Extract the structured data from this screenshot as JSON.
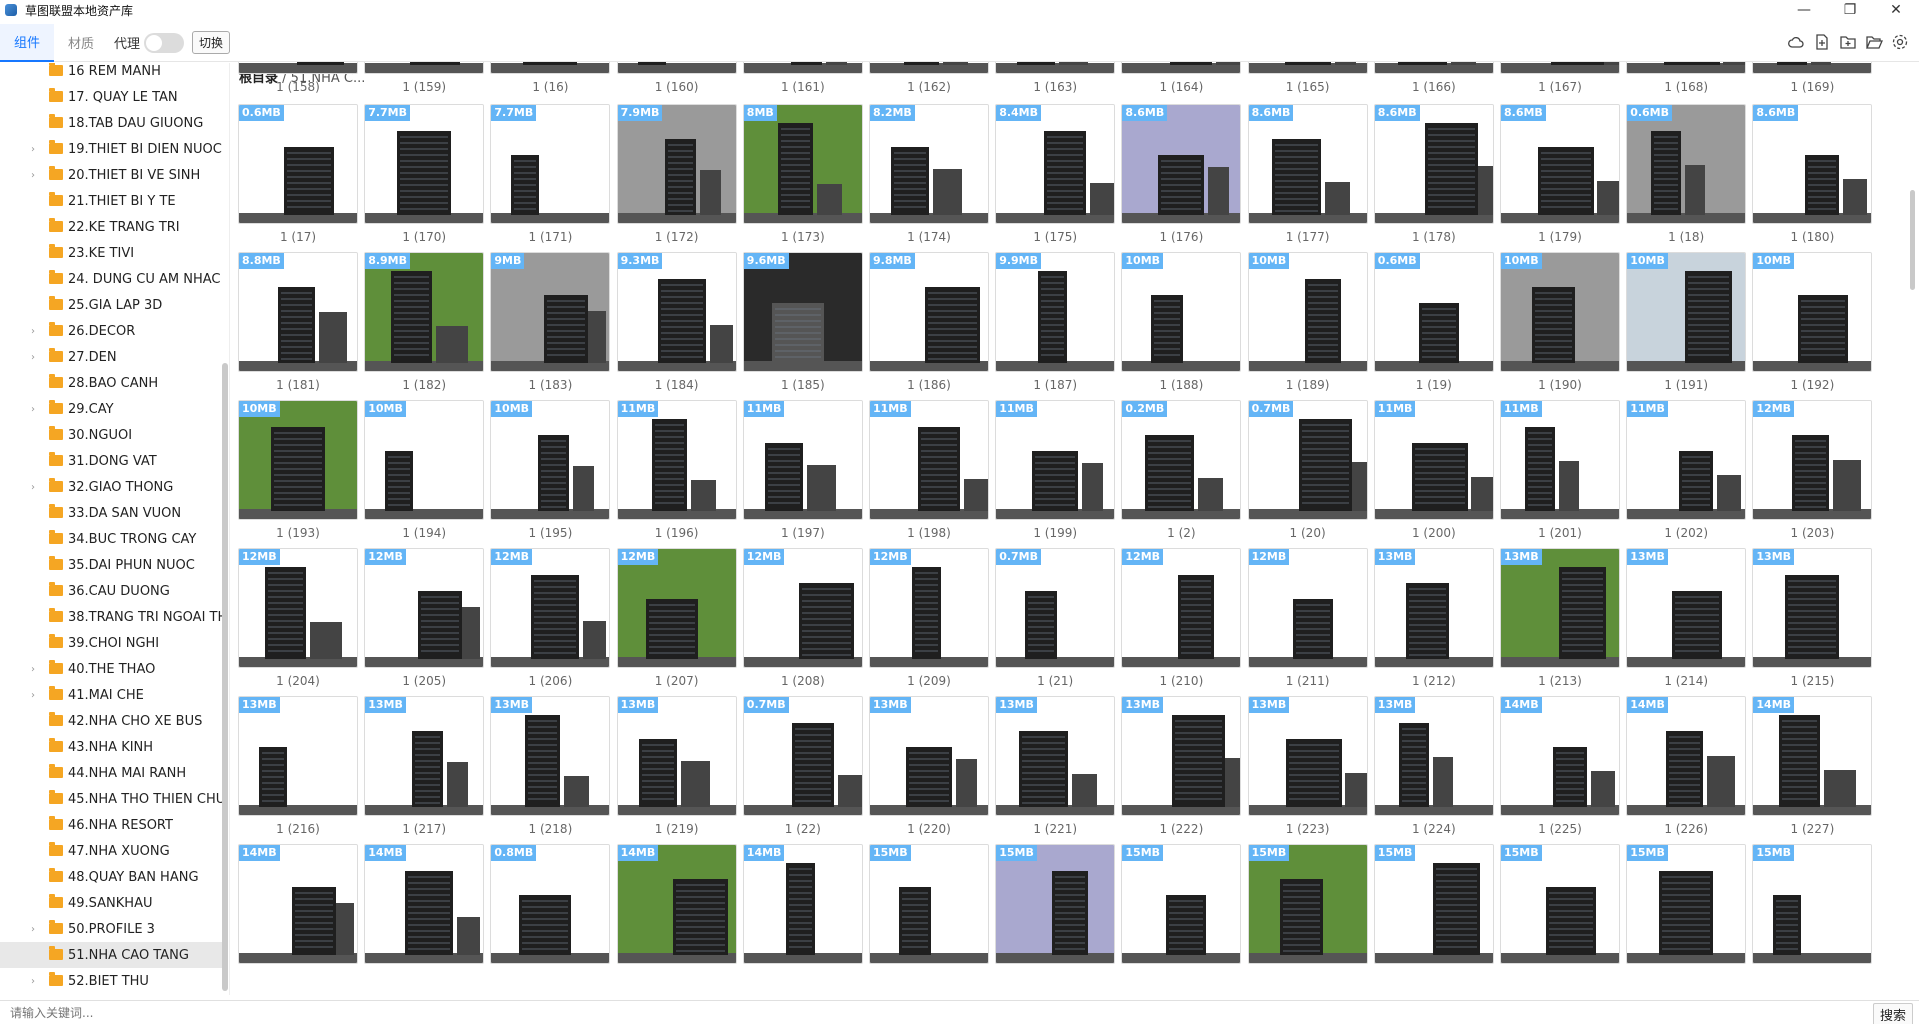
{
  "window": {
    "title": "草图联盟本地资产库",
    "minimize": "—",
    "maximize": "❐",
    "close": "✕"
  },
  "toolbar": {
    "tabs": [
      "组件",
      "材质"
    ],
    "proxy_label": "代理",
    "switch_label": "切换",
    "icons": [
      "cloud-icon",
      "add-file-icon",
      "add-folder-icon",
      "open-folder-icon",
      "settings-icon"
    ]
  },
  "breadcrumb": {
    "root": "根目录",
    "separator": " / ",
    "current": "51.NHA C..."
  },
  "sidebar": {
    "items": [
      {
        "label": "16 REM MANH",
        "caret": false
      },
      {
        "label": "17. QUAY LE TAN",
        "caret": false
      },
      {
        "label": "18.TAB DAU GIUONG",
        "caret": false
      },
      {
        "label": "19.THIET BI DIEN NUOC",
        "caret": true
      },
      {
        "label": "20.THIET BI VE SINH",
        "caret": true
      },
      {
        "label": "21.THIET BI Y TE",
        "caret": false
      },
      {
        "label": "22.KE TRANG TRI",
        "caret": false
      },
      {
        "label": "23.KE TIVI",
        "caret": false
      },
      {
        "label": "24. DUNG CU AM NHAC",
        "caret": false
      },
      {
        "label": "25.GIA LAP 3D",
        "caret": false
      },
      {
        "label": "26.DECOR",
        "caret": true
      },
      {
        "label": "27.DEN",
        "caret": true
      },
      {
        "label": "28.BAO CANH",
        "caret": false
      },
      {
        "label": "29.CAY",
        "caret": true
      },
      {
        "label": "30.NGUOI",
        "caret": false
      },
      {
        "label": "31.DONG VAT",
        "caret": false
      },
      {
        "label": "32.GIAO THONG",
        "caret": true
      },
      {
        "label": "33.DA SAN VUON",
        "caret": false
      },
      {
        "label": "34.BUC TRONG CAY",
        "caret": false
      },
      {
        "label": "35.DAI PHUN NUOC",
        "caret": false
      },
      {
        "label": "36.CAU DUONG",
        "caret": false
      },
      {
        "label": "38.TRANG TRI NGOAI TH",
        "caret": false
      },
      {
        "label": "39.CHOI NGHI",
        "caret": false
      },
      {
        "label": "40.THE THAO",
        "caret": true
      },
      {
        "label": "41.MAI CHE",
        "caret": true
      },
      {
        "label": "42.NHA CHO XE BUS",
        "caret": false
      },
      {
        "label": "43.NHA KINH",
        "caret": false
      },
      {
        "label": "44.NHA MAI RANH",
        "caret": false
      },
      {
        "label": "45.NHA THO THIEN CHU",
        "caret": false
      },
      {
        "label": "46.NHA RESORT",
        "caret": false
      },
      {
        "label": "47.NHA XUONG",
        "caret": false
      },
      {
        "label": "48.QUAY BAN HANG",
        "caret": false
      },
      {
        "label": "49.SANKHAU",
        "caret": false
      },
      {
        "label": "50.PROFILE 3",
        "caret": true
      },
      {
        "label": "51.NHA CAO TANG",
        "caret": false,
        "selected": true
      },
      {
        "label": "52.BIET THU",
        "caret": true
      }
    ]
  },
  "grid": {
    "top_captions": [
      "1 (158)",
      "1 (159)",
      "1 (16)",
      "1 (160)",
      "1 (161)",
      "1 (162)",
      "1 (163)",
      "1 (164)",
      "1 (165)",
      "1 (166)",
      "1 (167)",
      "1 (168)",
      "1 (169)"
    ],
    "rows": [
      [
        {
          "size": "0.6MB",
          "name": "1 (17)",
          "scene": "white"
        },
        {
          "size": "7.7MB",
          "name": "1 (170)",
          "scene": "white"
        },
        {
          "size": "7.7MB",
          "name": "1 (171)",
          "scene": "white"
        },
        {
          "size": "7.9MB",
          "name": "1 (172)",
          "scene": "grey"
        },
        {
          "size": "8MB",
          "name": "1 (173)",
          "scene": "green"
        },
        {
          "size": "8.2MB",
          "name": "1 (174)",
          "scene": "white"
        },
        {
          "size": "8.4MB",
          "name": "1 (175)",
          "scene": "white"
        },
        {
          "size": "8.6MB",
          "name": "1 (176)",
          "scene": "lavender"
        },
        {
          "size": "8.6MB",
          "name": "1 (177)",
          "scene": "white"
        },
        {
          "size": "8.6MB",
          "name": "1 (178)",
          "scene": "white"
        },
        {
          "size": "8.6MB",
          "name": "1 (179)",
          "scene": "white"
        },
        {
          "size": "0.6MB",
          "name": "1 (18)",
          "scene": "grey"
        },
        {
          "size": "8.6MB",
          "name": "1 (180)",
          "scene": "white"
        }
      ],
      [
        {
          "size": "8.8MB",
          "name": "1 (181)",
          "scene": "white"
        },
        {
          "size": "8.9MB",
          "name": "1 (182)",
          "scene": "green"
        },
        {
          "size": "9MB",
          "name": "1 (183)",
          "scene": "grey"
        },
        {
          "size": "9.3MB",
          "name": "1 (184)",
          "scene": "white"
        },
        {
          "size": "9.6MB",
          "name": "1 (185)",
          "scene": "dark"
        },
        {
          "size": "9.8MB",
          "name": "1 (186)",
          "scene": "white"
        },
        {
          "size": "9.9MB",
          "name": "1 (187)",
          "scene": "white"
        },
        {
          "size": "10MB",
          "name": "1 (188)",
          "scene": "white"
        },
        {
          "size": "10MB",
          "name": "1 (189)",
          "scene": "white"
        },
        {
          "size": "0.6MB",
          "name": "1 (19)",
          "scene": "white"
        },
        {
          "size": "10MB",
          "name": "1 (190)",
          "scene": "grey"
        },
        {
          "size": "10MB",
          "name": "1 (191)",
          "scene": "lightblue"
        },
        {
          "size": "10MB",
          "name": "1 (192)",
          "scene": "white"
        }
      ],
      [
        {
          "size": "10MB",
          "name": "1 (193)",
          "scene": "green"
        },
        {
          "size": "10MB",
          "name": "1 (194)",
          "scene": "white"
        },
        {
          "size": "10MB",
          "name": "1 (195)",
          "scene": "white"
        },
        {
          "size": "11MB",
          "name": "1 (196)",
          "scene": "white"
        },
        {
          "size": "11MB",
          "name": "1 (197)",
          "scene": "white"
        },
        {
          "size": "11MB",
          "name": "1 (198)",
          "scene": "white"
        },
        {
          "size": "11MB",
          "name": "1 (199)",
          "scene": "white"
        },
        {
          "size": "0.2MB",
          "name": "1 (2)",
          "scene": "white"
        },
        {
          "size": "0.7MB",
          "name": "1 (20)",
          "scene": "white"
        },
        {
          "size": "11MB",
          "name": "1 (200)",
          "scene": "white"
        },
        {
          "size": "11MB",
          "name": "1 (201)",
          "scene": "white"
        },
        {
          "size": "11MB",
          "name": "1 (202)",
          "scene": "white"
        },
        {
          "size": "12MB",
          "name": "1 (203)",
          "scene": "white"
        }
      ],
      [
        {
          "size": "12MB",
          "name": "1 (204)",
          "scene": "white"
        },
        {
          "size": "12MB",
          "name": "1 (205)",
          "scene": "white"
        },
        {
          "size": "12MB",
          "name": "1 (206)",
          "scene": "white"
        },
        {
          "size": "12MB",
          "name": "1 (207)",
          "scene": "green"
        },
        {
          "size": "12MB",
          "name": "1 (208)",
          "scene": "white"
        },
        {
          "size": "12MB",
          "name": "1 (209)",
          "scene": "white"
        },
        {
          "size": "0.7MB",
          "name": "1 (21)",
          "scene": "white"
        },
        {
          "size": "12MB",
          "name": "1 (210)",
          "scene": "white"
        },
        {
          "size": "12MB",
          "name": "1 (211)",
          "scene": "white"
        },
        {
          "size": "13MB",
          "name": "1 (212)",
          "scene": "white"
        },
        {
          "size": "13MB",
          "name": "1 (213)",
          "scene": "green"
        },
        {
          "size": "13MB",
          "name": "1 (214)",
          "scene": "white"
        },
        {
          "size": "13MB",
          "name": "1 (215)",
          "scene": "white"
        }
      ],
      [
        {
          "size": "13MB",
          "name": "1 (216)",
          "scene": "white"
        },
        {
          "size": "13MB",
          "name": "1 (217)",
          "scene": "white"
        },
        {
          "size": "13MB",
          "name": "1 (218)",
          "scene": "white"
        },
        {
          "size": "13MB",
          "name": "1 (219)",
          "scene": "white"
        },
        {
          "size": "0.7MB",
          "name": "1 (22)",
          "scene": "white"
        },
        {
          "size": "13MB",
          "name": "1 (220)",
          "scene": "white"
        },
        {
          "size": "13MB",
          "name": "1 (221)",
          "scene": "white"
        },
        {
          "size": "13MB",
          "name": "1 (222)",
          "scene": "white"
        },
        {
          "size": "13MB",
          "name": "1 (223)",
          "scene": "white"
        },
        {
          "size": "13MB",
          "name": "1 (224)",
          "scene": "white"
        },
        {
          "size": "14MB",
          "name": "1 (225)",
          "scene": "white"
        },
        {
          "size": "14MB",
          "name": "1 (226)",
          "scene": "white"
        },
        {
          "size": "14MB",
          "name": "1 (227)",
          "scene": "white"
        }
      ],
      [
        {
          "size": "14MB",
          "name": "",
          "scene": "white"
        },
        {
          "size": "14MB",
          "name": "",
          "scene": "white"
        },
        {
          "size": "0.8MB",
          "name": "",
          "scene": "white"
        },
        {
          "size": "14MB",
          "name": "",
          "scene": "green"
        },
        {
          "size": "14MB",
          "name": "",
          "scene": "white"
        },
        {
          "size": "15MB",
          "name": "",
          "scene": "white"
        },
        {
          "size": "15MB",
          "name": "",
          "scene": "lavender"
        },
        {
          "size": "15MB",
          "name": "",
          "scene": "white"
        },
        {
          "size": "15MB",
          "name": "",
          "scene": "green"
        },
        {
          "size": "15MB",
          "name": "",
          "scene": "white"
        },
        {
          "size": "15MB",
          "name": "",
          "scene": "white"
        },
        {
          "size": "15MB",
          "name": "",
          "scene": "white"
        },
        {
          "size": "15MB",
          "name": "",
          "scene": "white"
        }
      ]
    ]
  },
  "search": {
    "placeholder": "请输入关键词...",
    "button_label": "搜索"
  },
  "colors": {
    "accent": "#1677ff",
    "badge": "#64b5f6",
    "folder": "#f5a623"
  }
}
